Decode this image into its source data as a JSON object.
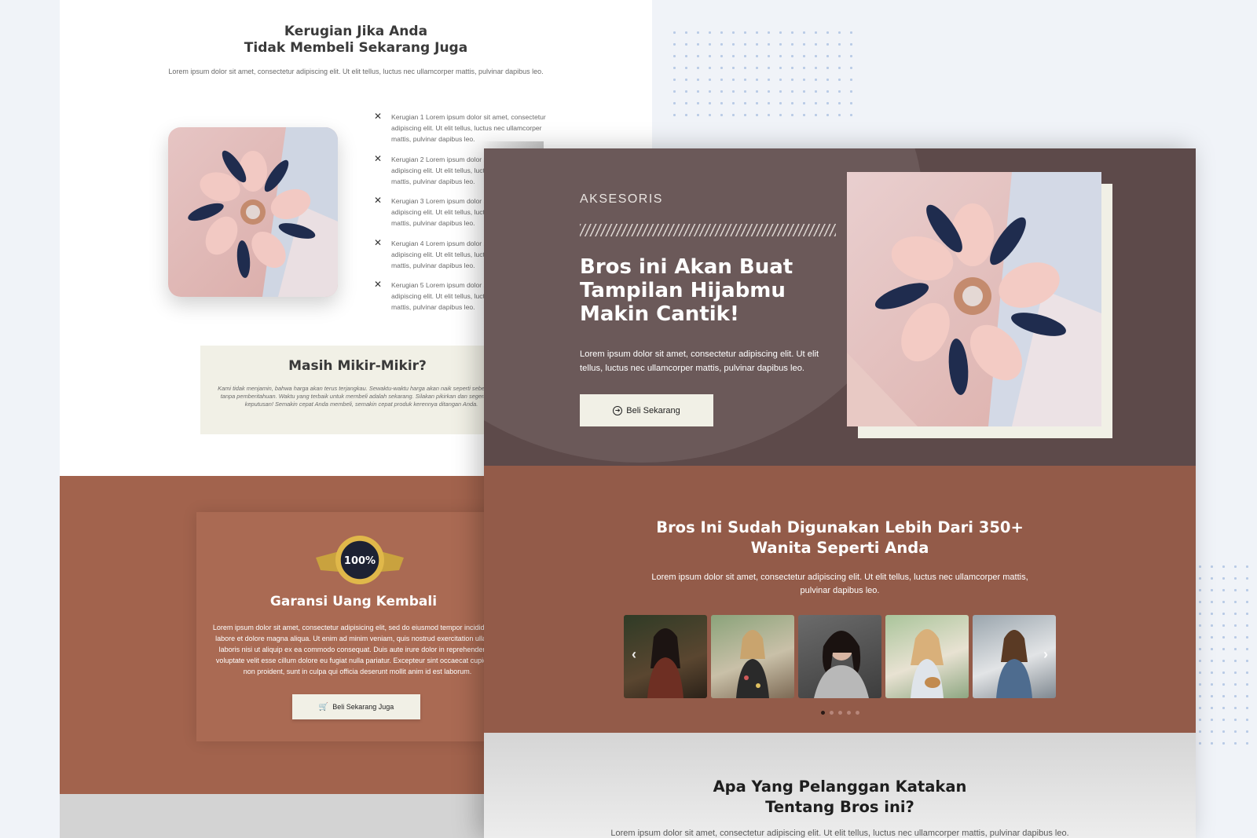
{
  "back_page": {
    "heading_line1": "Kerugian Jika Anda",
    "heading_line2": "Tidak Membeli Sekarang Juga",
    "subtitle": "Lorem ipsum dolor sit amet, consectetur adipiscing elit. Ut elit tellus, luctus nec ullamcorper mattis, pulvinar dapibus leo.",
    "loss_items": [
      "Kerugian 1 Lorem ipsum dolor sit amet, consectetur adipiscing elit. Ut elit tellus, luctus nec ullamcorper mattis, pulvinar dapibus leo.",
      "Kerugian 2 Lorem ipsum dolor sit amet, consectetur adipiscing elit. Ut elit tellus, luctus nec ullamcorper mattis, pulvinar dapibus leo.",
      "Kerugian 3 Lorem ipsum dolor sit amet, consectetur adipiscing elit. Ut elit tellus, luctus nec ullamcorper mattis, pulvinar dapibus leo.",
      "Kerugian 4 Lorem ipsum dolor sit amet, consectetur adipiscing elit. Ut elit tellus, luctus nec ullamcorper mattis, pulvinar dapibus leo.",
      "Kerugian 5 Lorem ipsum dolor sit amet, consectetur adipiscing elit. Ut elit tellus, luctus nec ullamcorper mattis, pulvinar dapibus leo."
    ],
    "doubt_title": "Masih Mikir-Mikir?",
    "doubt_body": "Kami tidak menjamin, bahwa harga akan terus terjangkau. Sewaktu-waktu harga akan naik seperti sebelumnya, tanpa pemberitahuan. Waktu yang terbaik untuk membeli adalah sekarang. Silakan pikirkan dan segera ambil keputusan! Semakin cepat Anda membeli, semakin cepat produk kerennya ditangan Anda.",
    "guarantee_badge_text": "100%",
    "guarantee_title": "Garansi Uang Kembali",
    "guarantee_body": "Lorem ipsum dolor sit amet, consectetur adipisicing elit, sed do eiusmod tempor incididunt ut labore et dolore magna aliqua. Ut enim ad minim veniam, quis nostrud exercitation ullamco laboris nisi ut aliquip ex ea commodo consequat. Duis aute irure dolor in reprehenderit in voluptate velit esse cillum dolore eu fugiat nulla pariatur. Excepteur sint occaecat cupidatat non proident, sunt in culpa qui officia deserunt mollit anim id est laborum.",
    "guarantee_button": "Beli Sekarang Juga"
  },
  "front_page": {
    "category": "AKSESORIS",
    "hero_title": "Bros ini Akan Buat Tampilan Hijabmu Makin Cantik!",
    "hero_desc": "Lorem ipsum dolor sit amet, consectetur adipiscing elit. Ut elit tellus, luctus nec ullamcorper mattis, pulvinar dapibus leo.",
    "hero_button": "Beli Sekarang",
    "users_title_line1": "Bros Ini Sudah Digunakan Lebih Dari 350+",
    "users_title_line2": "Wanita Seperti Anda",
    "users_desc": "Lorem ipsum dolor sit amet, consectetur adipiscing elit. Ut elit tellus, luctus nec ullamcorper mattis, pulvinar dapibus leo.",
    "gallery_photo_count": 5,
    "gallery_active_page": 1,
    "testimonials_title_line1": "Apa Yang Pelanggan Katakan",
    "testimonials_title_line2": "Tentang Bros ini?",
    "testimonials_desc": "Lorem ipsum dolor sit amet, consectetur adipiscing elit. Ut elit tellus, luctus nec ullamcorper mattis, pulvinar dapibus leo."
  },
  "icons": {
    "loss": "x-icon",
    "guarantee_button": "cart-icon",
    "hero_button": "circle-arrow-right-icon",
    "gallery_prev": "chevron-left-icon",
    "gallery_next": "chevron-right-icon"
  },
  "colors": {
    "hero_bg": "#5d4a4a",
    "users_bg": "#935b49",
    "guarantee_bg": "#a2634d",
    "cream": "#f1f0e6"
  }
}
